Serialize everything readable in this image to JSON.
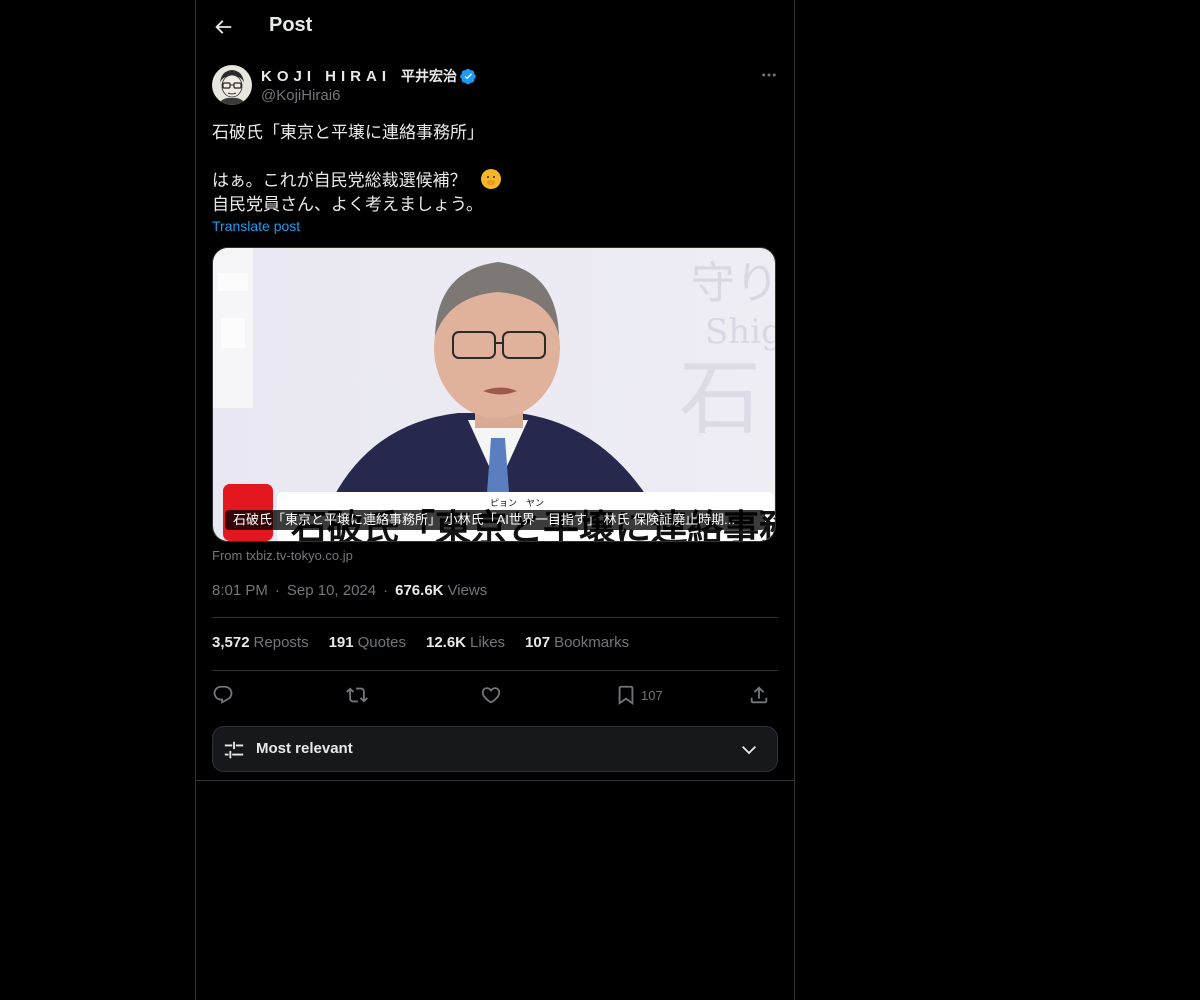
{
  "header": {
    "title": "Post"
  },
  "author": {
    "display_name": "KOJI HIRAI",
    "display_name_jp": "平井宏治",
    "handle": "@KojiHirai6",
    "verified": true
  },
  "post": {
    "lines": [
      "石破氏「東京と平壌に連絡事務所」",
      "",
      "はぁ。これが自民党総裁選候補？",
      "自民党員さん、よく考えましょう。"
    ],
    "translate_label": "Translate post",
    "media": {
      "caption": "石破氏「東京と平壌に連絡事務所」 小林氏「AI世界一目指す」 林氏 保険証廃止時期...",
      "source": "From txbiz.tv-tokyo.co.jp"
    },
    "time": "8:01 PM",
    "date": "Sep 10, 2024",
    "views_count": "676.6K",
    "views_label": "Views"
  },
  "stats": [
    {
      "count": "3,572",
      "label": "Reposts"
    },
    {
      "count": "191",
      "label": "Quotes"
    },
    {
      "count": "12.6K",
      "label": "Likes"
    },
    {
      "count": "107",
      "label": "Bookmarks"
    }
  ],
  "actions": {
    "bookmark_count": "107"
  },
  "sort": {
    "label": "Most relevant"
  },
  "colors": {
    "accent": "#1d9bf0",
    "background": "#000000",
    "muted": "#71767b",
    "border": "#2f3336"
  }
}
